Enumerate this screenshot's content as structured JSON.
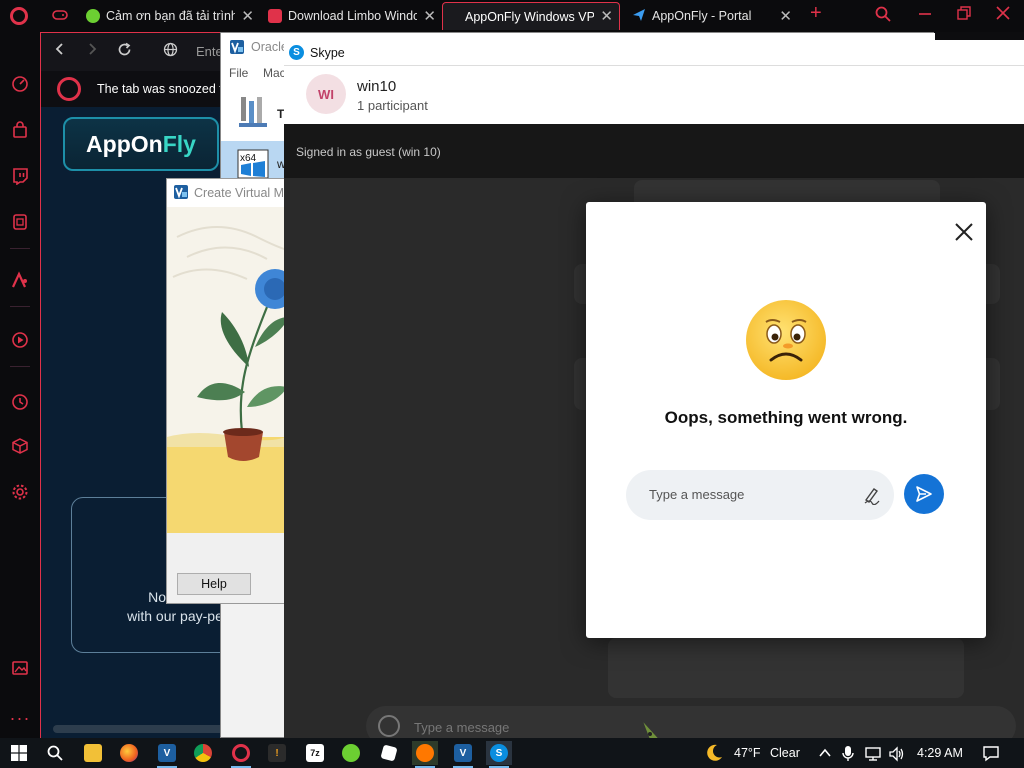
{
  "browser": {
    "tabs": [
      {
        "title": "Cảm ơn bạn đã tải trình",
        "favicon_color": "#6ccf32"
      },
      {
        "title": "Download Limbo Windo",
        "favicon_color": "#e0324a"
      },
      {
        "title": "AppOnFly Windows VPS",
        "favicon_color": "#e0324a"
      },
      {
        "title": "AppOnFly - Portal",
        "favicon_color": "#3b9cf0"
      }
    ],
    "address_placeholder": "Ente",
    "snooze_message": "The tab was snoozed to",
    "logo": {
      "main": "AppOn",
      "accent": "Fly"
    },
    "promo_line1": "No more",
    "promo_line2": "with our pay-pe"
  },
  "vbox": {
    "title": "Oracle",
    "menu": [
      "File",
      "Mac"
    ],
    "tools_label": "To",
    "vm_label": "w"
  },
  "wizard": {
    "title": "Create Virtual Ma",
    "help_label": "Help"
  },
  "skype": {
    "window_title": "Skype",
    "avatar_initials": "WI",
    "conversation_name": "win10",
    "participants": "1 participant",
    "guest_banner": "Signed in as guest (win 10)",
    "bottom_placeholder": "Type a message",
    "error": {
      "message": "Oops, something went wrong.",
      "input_placeholder": "Type a message"
    }
  },
  "taskbar": {
    "apps": [
      "start",
      "search",
      "file-explorer",
      "firefox",
      "virtualbox",
      "chrome",
      "opera",
      "limbo",
      "7zip",
      "coccoc",
      "roblox",
      "avast",
      "virtualbox-2",
      "skype"
    ],
    "weather_temp": "47°F",
    "weather_desc": "Clear",
    "time": "4:29 AM"
  },
  "colors": {
    "opera_red": "#e0324a",
    "skype_blue": "#1473d6",
    "appOnFly_teal": "#38d6c6"
  }
}
